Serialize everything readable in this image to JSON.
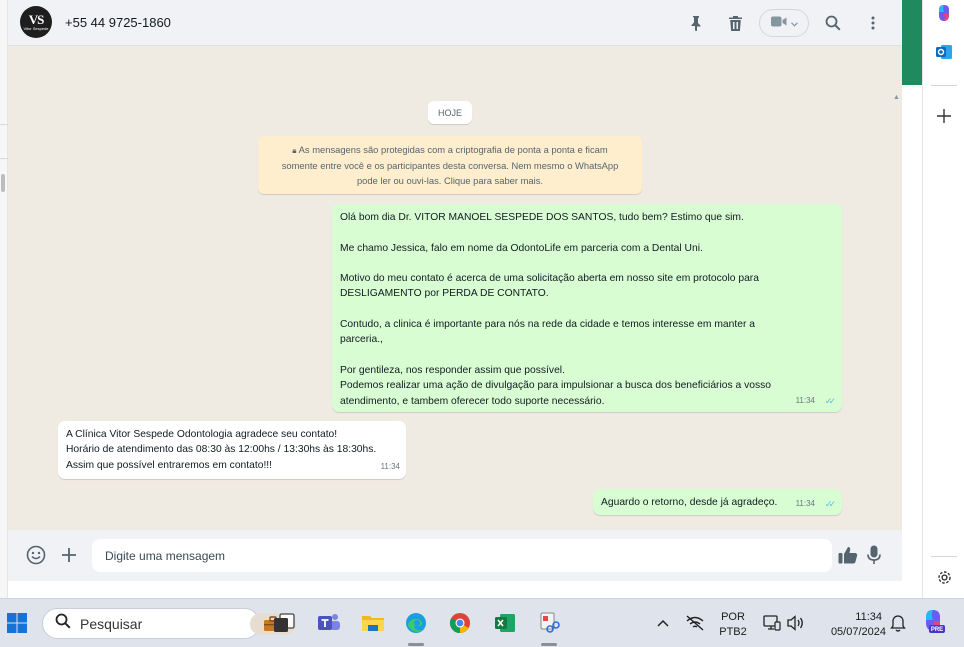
{
  "header": {
    "avatar_text": "VS",
    "avatar_subtext": "Vitor Sespede",
    "contact": "+55 44 9725-1860",
    "icons": [
      "pin-icon",
      "trash-icon",
      "video-call-icon",
      "chevron-down-icon",
      "search-icon",
      "more-options-icon"
    ]
  },
  "chat": {
    "day_label": "HOJE",
    "encryption_notice": {
      "lines": [
        "As mensagens são protegidas com a criptografia de ponta a ponta e ficam",
        "somente entre você e os participantes desta conversa. Nem mesmo o WhatsApp",
        "pode ler ou ouvi-las. Clique para saber mais."
      ]
    },
    "messages": [
      {
        "direction": "outgoing",
        "lines": [
          "Olá bom dia Dr. VITOR MANOEL SESPEDE DOS SANTOS, tudo bem? Estimo que sim.",
          "",
          "Me chamo Jessica, falo em nome da OdontoLife em parceria com a Dental Uni.",
          "",
          "Motivo do meu contato é acerca de uma solicitação aberta em nosso site em protocolo para",
          "DESLIGAMENTO por PERDA DE CONTATO.",
          "",
          "Contudo, a clinica é importante para nós na rede da cidade e temos interesse em manter a",
          "parceria.,",
          "",
          "Por gentileza, nos responder assim que possível.",
          "Podemos realizar uma ação de divulgação para impulsionar a busca dos beneficiários a vosso",
          "atendimento, e tambem oferecer todo suporte necessário."
        ],
        "time": "11:34",
        "read": true
      },
      {
        "direction": "incoming",
        "lines": [
          "A Clínica Vitor Sespede Odontologia agradece seu contato!",
          "Horário de atendimento das 08:30 às 12:00hs / 13:30hs às 18:30hs.",
          "Assim que possível entraremos em contato!!!"
        ],
        "time": "11:34"
      },
      {
        "direction": "outgoing",
        "lines": [
          "Aguardo o retorno, desde já agradeço."
        ],
        "time": "11:34",
        "read": true
      }
    ]
  },
  "composer": {
    "placeholder": "Digite uma mensagem",
    "icons": [
      "emoji-icon",
      "plus-icon",
      "thumbs-up-icon",
      "microphone-icon"
    ]
  },
  "edge_sidebar": {
    "icons": [
      "copilot-icon",
      "outlook-icon",
      "add-icon",
      "settings-icon"
    ]
  },
  "taskbar": {
    "search_label": "Pesquisar",
    "language": [
      "POR",
      "PTB2"
    ],
    "time": "11:34",
    "date": "05/07/2024",
    "copilot_badge": "PRE",
    "colors": {
      "whatsapp_green": "#1f8a5e",
      "outgoing_bubble": "#d9fdd3",
      "read_ticks": "#53bdeb"
    }
  }
}
